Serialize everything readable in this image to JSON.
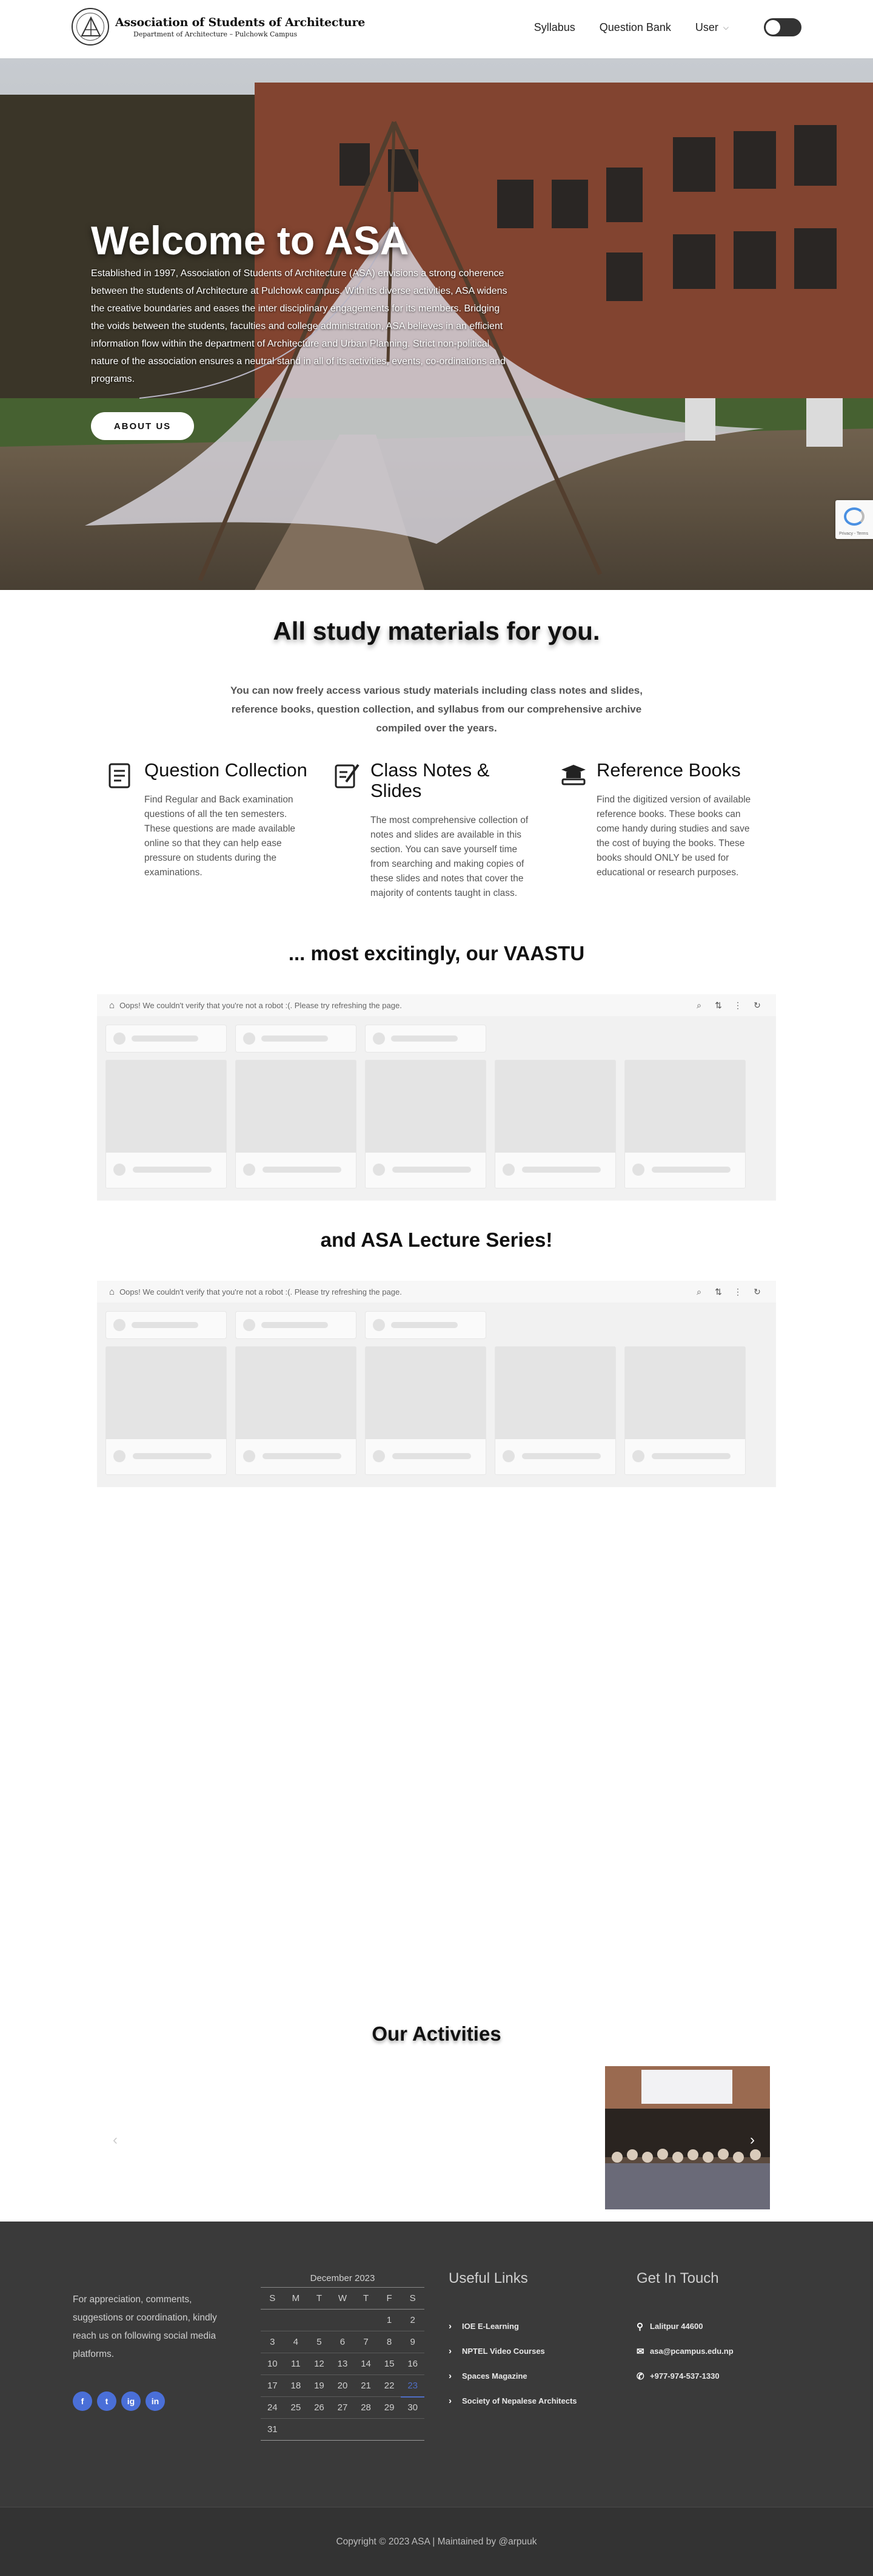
{
  "header": {
    "logo_title": "Association of Students of Architecture",
    "logo_subtitle": "Department of Architecture – Pulchowk Campus",
    "nav": {
      "syllabus": "Syllabus",
      "question_bank": "Question Bank",
      "user": "User"
    }
  },
  "hero": {
    "title": "Welcome to ASA",
    "text": "Established in 1997, Association of Students of Architecture (ASA) envisions a strong coherence between the students of Architecture at Pulchowk campus. With its diverse activities, ASA widens the creative boundaries and eases the inter disciplinary engagements for its members. Bridging the voids between the students, faculties and college administration, ASA believes in an efficient information flow within the department of Architecture and Urban Planning. Strict non-political nature of the association ensures a neutral stand in all of its activities, events, co-ordinations and programs.",
    "button": "ABOUT US",
    "recaptcha_label": "Privacy - Terms"
  },
  "study": {
    "title": "All study materials for you.",
    "description": "You can now freely access various study materials including class notes and slides, reference books, question collection, and syllabus from our comprehensive archive compiled over the years.",
    "features": [
      {
        "icon": "question-collection-icon",
        "title": "Question Collection",
        "text": "Find Regular and Back examination questions of all the ten semesters. These questions are made available online so that they can help ease pressure on students during the examinations."
      },
      {
        "icon": "class-notes-icon",
        "title": "Class Notes & Slides",
        "text": "The most comprehensive collection of notes and slides are available in this section. You can save yourself time from searching and making copies of these slides and notes that cover the majority of contents taught in class."
      },
      {
        "icon": "reference-books-icon",
        "title": "Reference Books",
        "text": "Find the digitized version of available reference books. These books can come handy during studies and save the cost of buying the books. These books should ONLY be used for educational or research purposes."
      }
    ]
  },
  "vaastu": {
    "title": "... most excitingly, our VAASTU",
    "notice": "Oops! We couldn't verify that you're not a robot :(. Please try refreshing the page."
  },
  "lectures": {
    "title": "and ASA Lecture Series!",
    "notice": "Oops! We couldn't verify that you're not a robot :(. Please try refreshing the page."
  },
  "activities": {
    "title": "Our Activities"
  },
  "footer": {
    "about_text": "For appreciation, comments, suggestions or coordination, kindly reach us on following social media platforms.",
    "socials": [
      "f",
      "t",
      "ig",
      "in"
    ],
    "calendar": {
      "caption": "December 2023",
      "weekdays": [
        "S",
        "M",
        "T",
        "W",
        "T",
        "F",
        "S"
      ],
      "weeks": [
        [
          "",
          "",
          "",
          "",
          "",
          "1",
          "2"
        ],
        [
          "3",
          "4",
          "5",
          "6",
          "7",
          "8",
          "9"
        ],
        [
          "10",
          "11",
          "12",
          "13",
          "14",
          "15",
          "16"
        ],
        [
          "17",
          "18",
          "19",
          "20",
          "21",
          "22",
          "23"
        ],
        [
          "24",
          "25",
          "26",
          "27",
          "28",
          "29",
          "30"
        ],
        [
          "31",
          "",
          "",
          "",
          "",
          "",
          ""
        ]
      ],
      "today": "23"
    },
    "useful_links_title": "Useful Links",
    "useful_links": [
      "IOE E-Learning",
      "NPTEL Video Courses",
      "Spaces Magazine",
      "Society of Nepalese Architects"
    ],
    "contact_title": "Get In Touch",
    "contact": {
      "location": "Lalitpur 44600",
      "email": "asa@pcampus.edu.np",
      "phone": "+977-974-537-1330"
    },
    "copyright": "Copyright © 2023 ASA | Maintained by @arpuuk"
  },
  "colors": {
    "accent": "#4a6fd8",
    "footer_bg": "#3a3a3a",
    "today": "#4f6ec5"
  }
}
